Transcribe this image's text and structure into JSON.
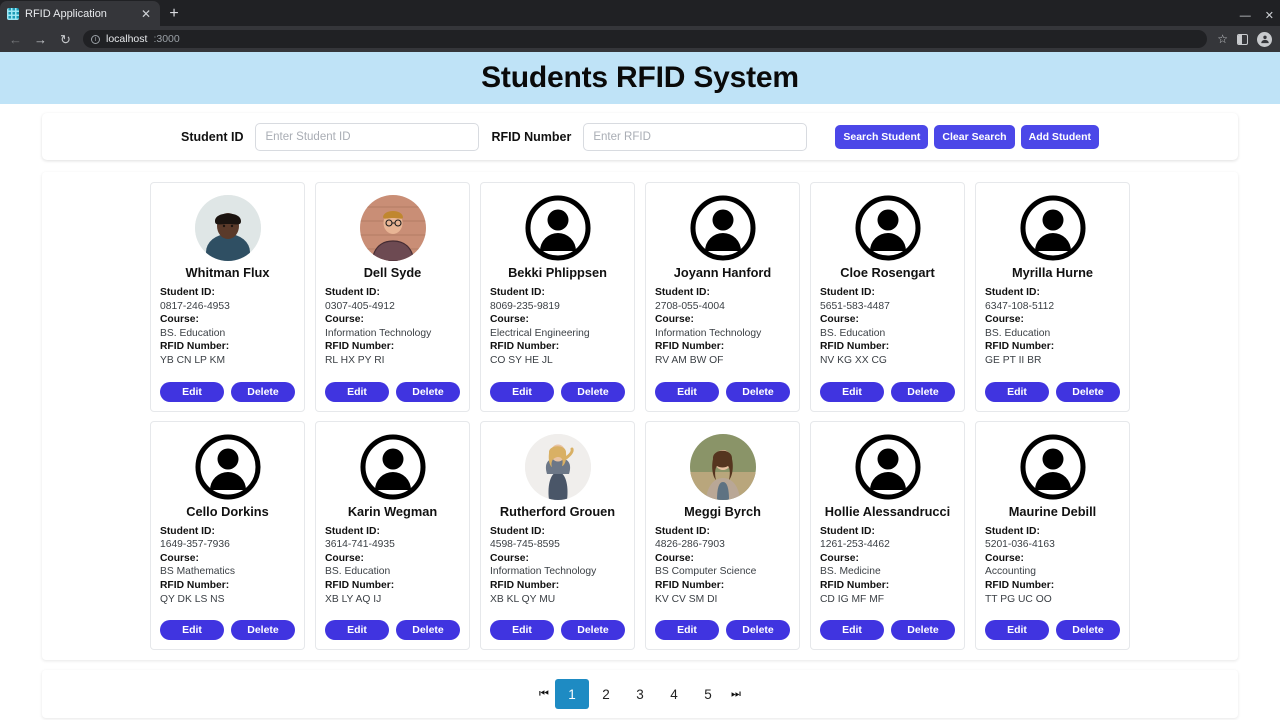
{
  "browser": {
    "tab_title": "RFID Application",
    "tab_close_icon": "close-icon",
    "new_tab_icon": "+",
    "back_icon": "←",
    "forward_icon": "→",
    "reload_icon": "↻",
    "info_icon": "i",
    "url_host": "localhost",
    "url_port": ":3000",
    "bookmark_icon": "☆",
    "split_icon": "split-panel-icon",
    "profile_initial": "●",
    "minimize_icon": "—",
    "close_window_icon": "✕"
  },
  "header": {
    "title": "Students RFID System",
    "bg_color": "#bfe3f7"
  },
  "search": {
    "student_id_label": "Student ID",
    "student_id_placeholder": "Enter Student ID",
    "student_id_value": "",
    "rfid_label": "RFID Number",
    "rfid_placeholder": "Enter RFID",
    "rfid_value": "",
    "buttons": [
      {
        "label": "Search Student",
        "name": "search-student-button"
      },
      {
        "label": "Clear Search",
        "name": "clear-search-button"
      },
      {
        "label": "Add Student",
        "name": "add-student-button"
      }
    ],
    "button_color": "#4b47e8"
  },
  "card_labels": {
    "student_id": "Student ID:",
    "course": "Course:",
    "rfid_number": "RFID Number:",
    "edit": "Edit",
    "delete": "Delete"
  },
  "students": [
    {
      "name": "Whitman Flux",
      "student_id": "0817-246-4953",
      "course": "BS. Education",
      "rfid": "YB CN LP KM",
      "avatar": "photo-dark-curly"
    },
    {
      "name": "Dell Syde",
      "student_id": "0307-405-4912",
      "course": "Information Technology",
      "rfid": "RL HX PY RI",
      "avatar": "photo-glasses-plaid"
    },
    {
      "name": "Bekki Phlippsen",
      "student_id": "8069-235-9819",
      "course": "Electrical Engineering",
      "rfid": "CO SY HE JL",
      "avatar": "default-silhouette"
    },
    {
      "name": "Joyann Hanford",
      "student_id": "2708-055-4004",
      "course": "Information Technology",
      "rfid": "RV AM BW OF",
      "avatar": "default-silhouette"
    },
    {
      "name": "Cloe Rosengart",
      "student_id": "5651-583-4487",
      "course": "BS. Education",
      "rfid": "NV KG XX CG",
      "avatar": "default-silhouette"
    },
    {
      "name": "Myrilla Hurne",
      "student_id": "6347-108-5112",
      "course": "BS. Education",
      "rfid": "GE PT II BR",
      "avatar": "default-silhouette"
    },
    {
      "name": "Cello Dorkins",
      "student_id": "1649-357-7936",
      "course": "BS Mathematics",
      "rfid": "QY DK LS NS",
      "avatar": "default-silhouette"
    },
    {
      "name": "Karin Wegman",
      "student_id": "3614-741-4935",
      "course": "BS. Education",
      "rfid": "XB LY AQ IJ",
      "avatar": "default-silhouette"
    },
    {
      "name": "Rutherford Grouen",
      "student_id": "4598-745-8595",
      "course": "Information Technology",
      "rfid": "XB KL QY MU",
      "avatar": "photo-blonde-standing"
    },
    {
      "name": "Meggi Byrch",
      "student_id": "4826-286-7903",
      "course": "BS Computer Science",
      "rfid": "KV CV SM DI",
      "avatar": "photo-brunette-outdoor"
    },
    {
      "name": "Hollie Alessandrucci",
      "student_id": "1261-253-4462",
      "course": "BS. Medicine",
      "rfid": "CD IG MF MF",
      "avatar": "default-silhouette"
    },
    {
      "name": "Maurine Debill",
      "student_id": "5201-036-4163",
      "course": "Accounting",
      "rfid": "TT PG UC OO",
      "avatar": "default-silhouette"
    }
  ],
  "pagination": {
    "first_icon": "⏮",
    "last_icon": "⏭",
    "pages": [
      "1",
      "2",
      "3",
      "4",
      "5"
    ],
    "active_page": "1",
    "active_color": "#1e8bc3"
  }
}
